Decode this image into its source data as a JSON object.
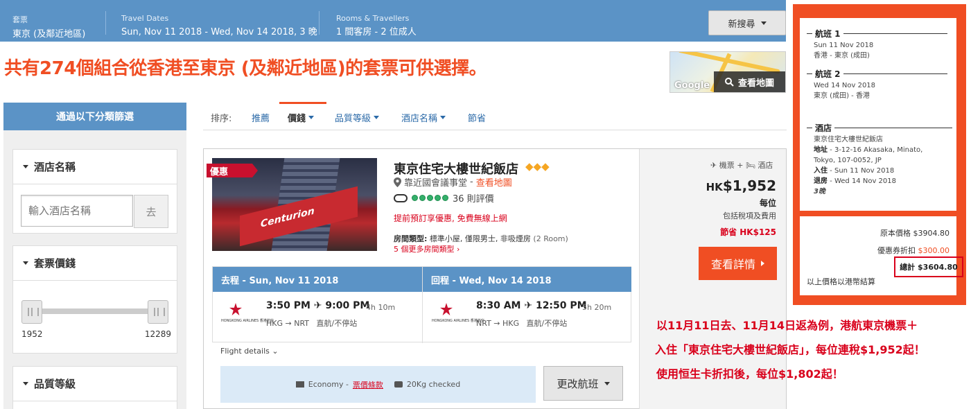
{
  "search_bar": {
    "package_label": "套票",
    "package_value": "東京 (及鄰近地區)",
    "dates_label": "Travel Dates",
    "dates_value": "Sun, Nov 11 2018 - Wed, Nov 14 2018, 3 晚",
    "rooms_label": "Rooms & Travellers",
    "rooms_value": "1 間客房 - 2 位成人",
    "new_search_label": "新搜尋"
  },
  "headline": {
    "prefix": "共有",
    "count": "274",
    "suffix": "個組合從香港至東京 (及鄰近地區)的套票可供選擇。"
  },
  "map": {
    "logo_text": "Google",
    "button_label": "查看地圖"
  },
  "sidebar": {
    "header": "通過以下分類篩選",
    "hotel_name_title": "酒店名稱",
    "hotel_name_placeholder": "輸入酒店名稱",
    "go_label": "去",
    "price_title": "套票價錢",
    "price_min": "1952",
    "price_max": "12289",
    "quality_title": "品質等級"
  },
  "sort": {
    "label": "排序:",
    "items": [
      "推薦",
      "價錢",
      "品質等級",
      "酒店名稱",
      "節省"
    ],
    "active_index": 1
  },
  "result": {
    "promo_badge": "優惠",
    "photo_sign": "Centurion",
    "hotel_name": "東京住宅大樓世紀飯店",
    "stars": "◆◆◆",
    "location": "靠近國會議事堂",
    "location_sep": " - ",
    "map_link": "查看地圖",
    "reviews": "36 則評價",
    "promo_text": "提前預訂享優惠, 免費無線上網",
    "room_type_label": "房間類型:",
    "room_type_value": "標準小屋, 僅限男士, 非吸煙房",
    "room_type_extra": "(2 Room)",
    "more_rooms": "5 個更多房間類型",
    "bundle_label": "✈ 機票 + 🛏 酒店",
    "price_currency": "HK",
    "price_value": "$1,952",
    "per_person": "每位",
    "tax_note": "包括稅項及費用",
    "saving": "節省 HK$125",
    "details_button": "查看詳情"
  },
  "flights": {
    "outbound_header": "去程 - Sun, Nov 11 2018",
    "return_header": "回程 - Wed, Nov 14 2018",
    "airline_name": "HONGKONG AIRLINES 香港航空",
    "outbound": {
      "depart": "3:50 PM",
      "arrive": "9:00 PM",
      "duration": "4h 10m",
      "route": "HKG → NRT",
      "stops": "直航/不停站"
    },
    "return": {
      "depart": "8:30 AM",
      "arrive": "12:50 PM",
      "duration": "5h 20m",
      "route": "NRT → HKG",
      "stops": "直航/不停站"
    },
    "details_label": "Flight details",
    "cabin": "Economy -",
    "fare_rules": "票價條款",
    "baggage": "20Kg checked",
    "change_button": "更改航班"
  },
  "summary": {
    "flight1_title": "航班 1",
    "flight1_date": "Sun 11 Nov 2018",
    "flight1_route": "香港 - 東京 (成田)",
    "flight2_title": "航班 2",
    "flight2_date": "Wed 14 Nov 2018",
    "flight2_route": "東京 (成田) - 香港",
    "hotel_title": "酒店",
    "hotel_name": "東京住宅大樓世紀飯店",
    "address_label": "地址",
    "address_line1": " - 3-12-16 Akasaka, Minato,",
    "address_line2": "Tokyo, 107-0052, JP",
    "checkin_label": "入住",
    "checkin_value": " - Sun 11 Nov 2018",
    "checkout_label": "退房",
    "checkout_value": " - Wed 14 Nov 2018",
    "nights": "3晚",
    "original_label": "原本價格",
    "original_value": "$3904.80",
    "coupon_label": "優惠券折扣",
    "coupon_value": "$300.00",
    "total_label": "總計",
    "total_value": "$3604.80",
    "currency_note": "以上價格以港幣結算"
  },
  "annotation": {
    "line1": "以11月11日去、11月14日返為例，港航東京機票＋",
    "line2": "入住「東京住宅大樓世紀飯店」，每位連稅$1,952起！",
    "line3": "使用恒生卡折扣後，每位$1,802起！"
  },
  "colors": {
    "accent": "#f04e23",
    "header_blue": "#5b93c6",
    "alert_red": "#d9001b"
  }
}
